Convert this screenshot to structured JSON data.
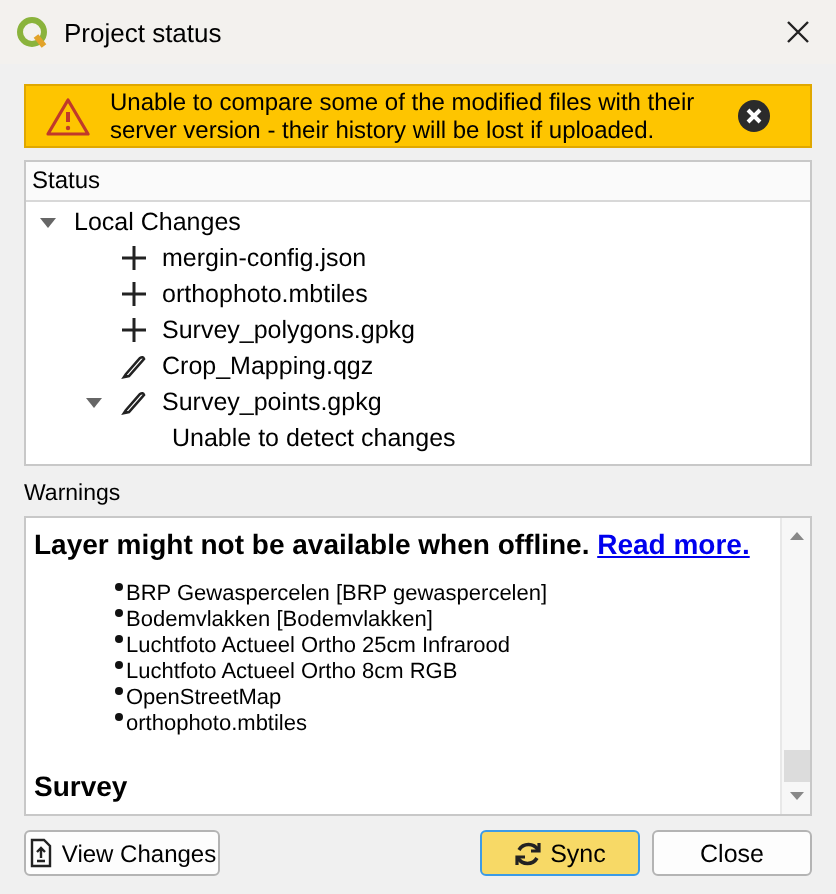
{
  "window": {
    "title": "Project status"
  },
  "alert": {
    "message": "Unable to compare some of the modified files with their server version - their history will be lost if uploaded."
  },
  "status": {
    "header": "Status",
    "tree": [
      {
        "label": "Local Changes",
        "expanded": true,
        "children": [
          {
            "kind": "added",
            "label": "mergin-config.json"
          },
          {
            "kind": "added",
            "label": "orthophoto.mbtiles"
          },
          {
            "kind": "added",
            "label": "Survey_polygons.gpkg"
          },
          {
            "kind": "modified",
            "label": "Crop_Mapping.qgz"
          },
          {
            "kind": "modified",
            "label": "Survey_points.gpkg",
            "expanded": true,
            "children": [
              {
                "kind": "message",
                "label": "Unable to detect changes"
              }
            ]
          }
        ]
      }
    ]
  },
  "warnings": {
    "label": "Warnings",
    "heading": "Layer might not be available when offline.",
    "link": "Read more.",
    "layers": [
      "BRP Gewaspercelen [BRP gewaspercelen]",
      "Bodemvlakken [Bodemvlakken]",
      "Luchtfoto Actueel Ortho 25cm Infrarood",
      "Luchtfoto Actueel Ortho 8cm RGB",
      "OpenStreetMap",
      "orthophoto.mbtiles"
    ],
    "section": "Survey"
  },
  "buttons": [
    {
      "kind": "view",
      "label": "View Changes"
    },
    {
      "kind": "sync",
      "label": "Sync"
    },
    {
      "kind": "close",
      "label": "Close"
    }
  ]
}
